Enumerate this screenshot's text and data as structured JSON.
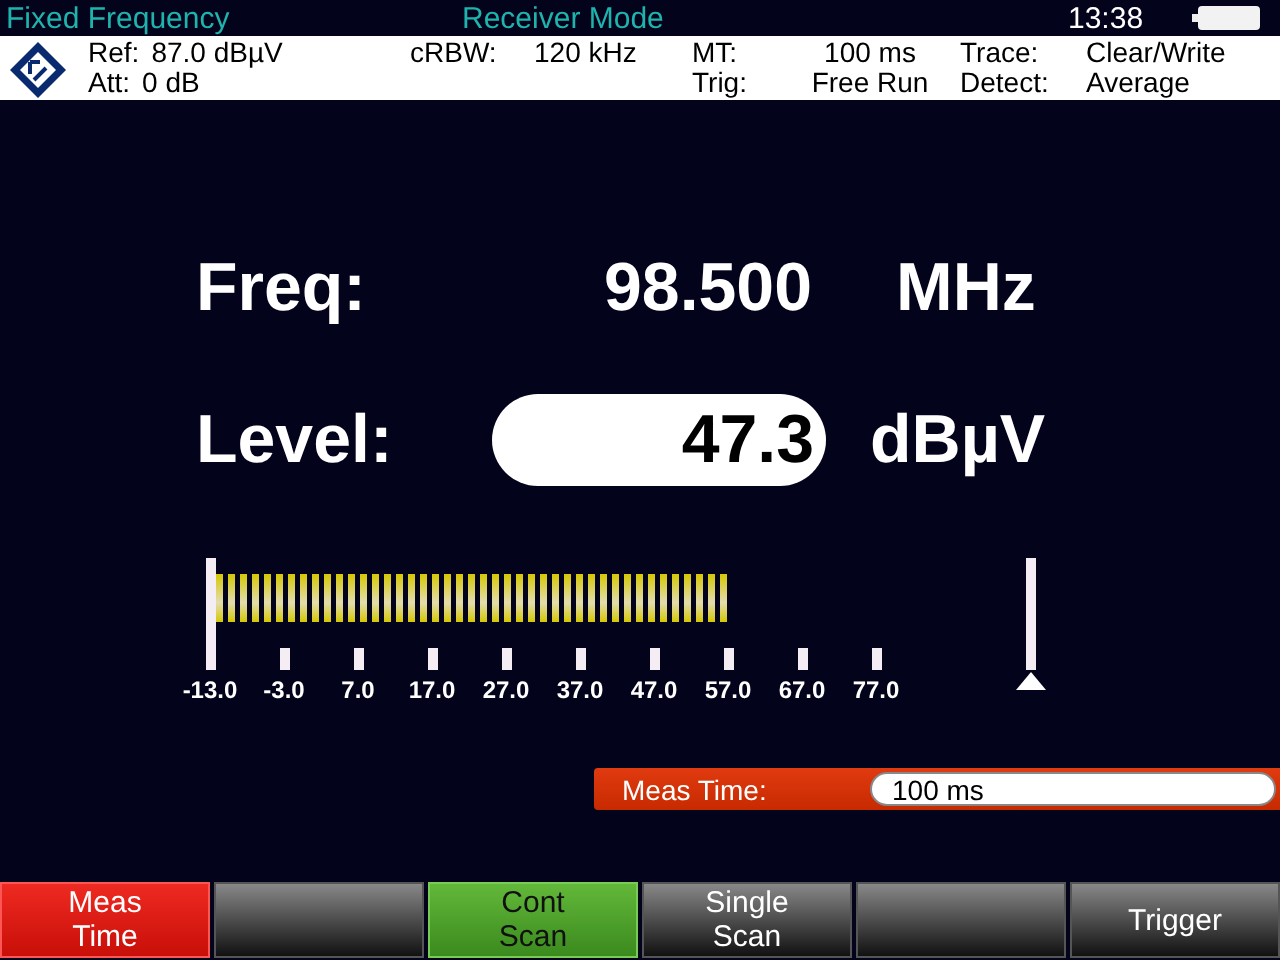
{
  "title_bar": {
    "mode": "Fixed Frequency",
    "title": "Receiver Mode",
    "time": "13:38"
  },
  "info": [
    {
      "label": "Ref:",
      "value": "87.0 dBµV"
    },
    {
      "label": "Att:",
      "value": "0 dB"
    },
    {
      "label": "cRBW:",
      "value": "120 kHz"
    },
    {
      "label": "MT:",
      "value": "100 ms"
    },
    {
      "label": "Trig:",
      "value": "Free Run"
    },
    {
      "label": "Trace:",
      "value": "Clear/Write"
    },
    {
      "label": "Detect:",
      "value": "Average"
    }
  ],
  "freq": {
    "label": "Freq:",
    "value": "98.500",
    "unit": "MHz"
  },
  "level": {
    "label": "Level:",
    "value": "47.3",
    "unit": "dBµV"
  },
  "meter": {
    "ticks": [
      "-13.0",
      "-3.0",
      "7.0",
      "17.0",
      "27.0",
      "37.0",
      "47.0",
      "57.0",
      "67.0",
      "77.0"
    ]
  },
  "entry": {
    "label": "Meas Time:",
    "value": "100 ms"
  },
  "softkeys": [
    {
      "label": "Meas Time",
      "kind": "active"
    },
    {
      "kind": "normal"
    },
    {
      "label": "Cont Scan",
      "kind": "on"
    },
    {
      "label": "Single Scan",
      "kind": "normal"
    },
    {
      "kind": "normal"
    },
    {
      "label": "Trigger",
      "kind": "normal"
    }
  ]
}
